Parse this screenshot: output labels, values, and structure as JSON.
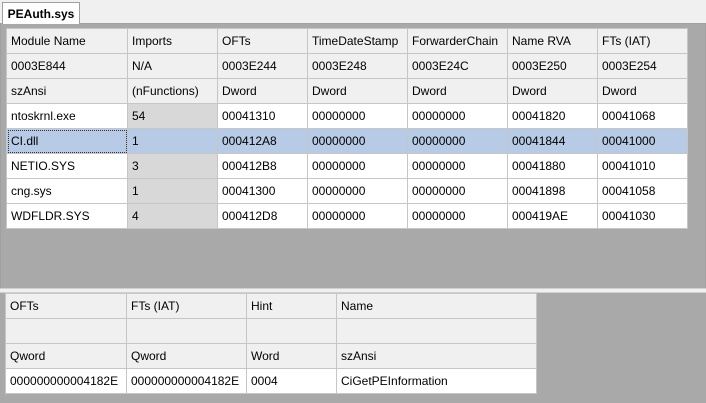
{
  "tab": {
    "label": "PEAuth.sys"
  },
  "imports_table": {
    "headers": [
      "Module Name",
      "Imports",
      "OFTs",
      "TimeDateStamp",
      "ForwarderChain",
      "Name RVA",
      "FTs (IAT)"
    ],
    "offsets": [
      "0003E844",
      "N/A",
      "0003E244",
      "0003E248",
      "0003E24C",
      "0003E250",
      "0003E254"
    ],
    "types": [
      "szAnsi",
      "(nFunctions)",
      "Dword",
      "Dword",
      "Dword",
      "Dword",
      "Dword"
    ],
    "rows": [
      [
        "ntoskrnl.exe",
        "54",
        "00041310",
        "00000000",
        "00000000",
        "00041820",
        "00041068"
      ],
      [
        "CI.dll",
        "1",
        "000412A8",
        "00000000",
        "00000000",
        "00041844",
        "00041000"
      ],
      [
        "NETIO.SYS",
        "3",
        "000412B8",
        "00000000",
        "00000000",
        "00041880",
        "00041010"
      ],
      [
        "cng.sys",
        "1",
        "00041300",
        "00000000",
        "00000000",
        "00041898",
        "00041058"
      ],
      [
        "WDFLDR.SYS",
        "4",
        "000412D8",
        "00000000",
        "00000000",
        "000419AE",
        "00041030"
      ]
    ],
    "selected_row": 1
  },
  "functions_table": {
    "headers": [
      "OFTs",
      "FTs (IAT)",
      "Hint",
      "Name"
    ],
    "offsets": [
      "",
      "",
      "",
      ""
    ],
    "types": [
      "Qword",
      "Qword",
      "Word",
      "szAnsi"
    ],
    "rows": [
      [
        "000000000004182E",
        "000000000004182E",
        "0004",
        "CiGetPEInformation"
      ]
    ]
  },
  "colors": {
    "selection": "#b8cbe6",
    "imports_cell": "#d8d8d8",
    "empty_area": "#a9a9a9"
  }
}
